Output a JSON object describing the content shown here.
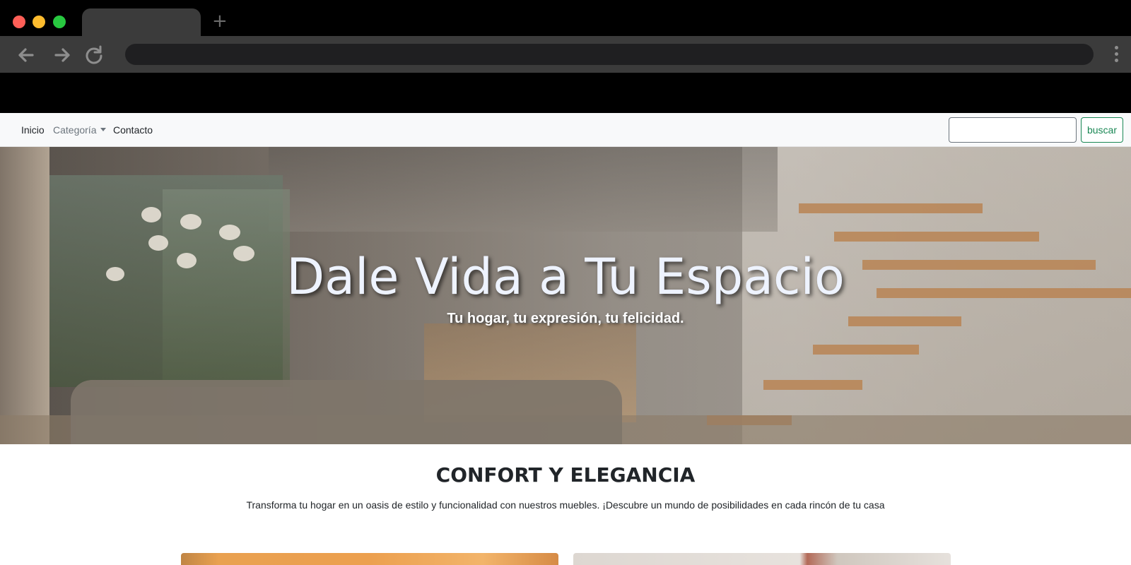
{
  "navbar": {
    "links": [
      {
        "label": "Inicio"
      },
      {
        "label": "Categoría"
      },
      {
        "label": "Contacto"
      }
    ],
    "search": {
      "value": "",
      "button_label": "buscar"
    }
  },
  "hero": {
    "title": "Dale Vida a Tu Espacio",
    "subtitle": "Tu hogar, tu expresión, tu felicidad."
  },
  "section": {
    "title": "CONFORT Y ELEGANCIA",
    "text": "Transforma tu hogar en un oasis de estilo y funcionalidad con nuestros muebles. ¡Descubre un mundo de posibilidades en cada rincón de tu casa"
  },
  "colors": {
    "accent_green": "#198754",
    "navbar_bg": "#f8f9fa"
  },
  "icons": {
    "back": "arrow-left-icon",
    "forward": "arrow-right-icon",
    "reload": "reload-icon",
    "new_tab": "plus-icon",
    "menu": "kebab-menu-icon",
    "dropdown": "caret-down-icon"
  }
}
